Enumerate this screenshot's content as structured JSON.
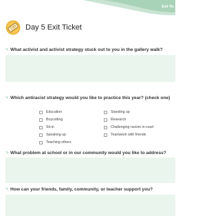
{
  "banner": {
    "tag": "Exit Tic"
  },
  "title": "Day 5 Exit Ticket",
  "questions": {
    "q1": "What activist and activist strategy stuck out to you in the gallery walk?",
    "q2": "Which antiracist strategy would you like to practice this year? (check one)",
    "q3": "What problem at school or in our community would you like to address?",
    "q4": "How can your friends, family, community, or teacher support you?"
  },
  "options": {
    "left": [
      "Education",
      "Boycotting",
      "Sit-in",
      "Speaking up",
      "Teaching others"
    ],
    "right": [
      "Standing up",
      "Research",
      "Challenging racism in court",
      "Teamwork with friends"
    ]
  },
  "colors": {
    "accent": "#8cc9a0",
    "answer_bg": "#eaf5ee",
    "banner_green": "#b9dcc4"
  }
}
